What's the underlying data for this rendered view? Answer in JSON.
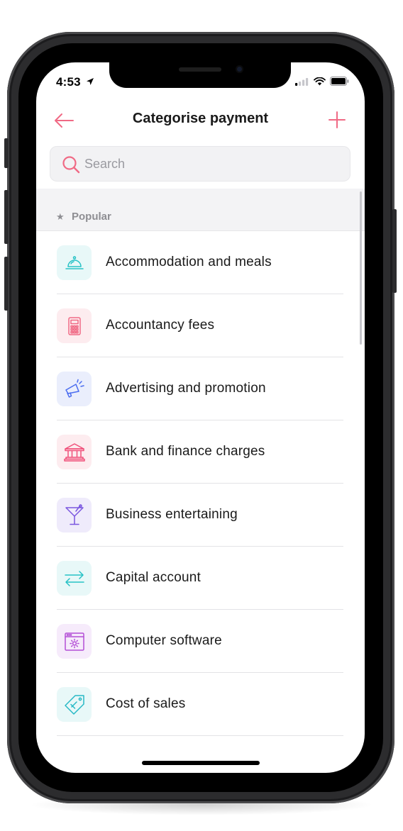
{
  "status_bar": {
    "time": "4:53"
  },
  "header": {
    "title": "Categorise payment"
  },
  "search": {
    "placeholder": "Search"
  },
  "section": {
    "label": "Popular"
  },
  "categories": [
    {
      "label": "Accommodation and meals",
      "icon": "service-bell-icon",
      "color": "#27c2c6",
      "bg": "#e8f8f8"
    },
    {
      "label": "Accountancy fees",
      "icon": "calculator-icon",
      "color": "#f06a85",
      "bg": "#fdecef"
    },
    {
      "label": "Advertising and promotion",
      "icon": "megaphone-icon",
      "color": "#4a6cf0",
      "bg": "#eaeefc"
    },
    {
      "label": "Bank and finance charges",
      "icon": "bank-icon",
      "color": "#f0507a",
      "bg": "#fdecef"
    },
    {
      "label": "Business entertaining",
      "icon": "cocktail-icon",
      "color": "#7a56e0",
      "bg": "#efebfb"
    },
    {
      "label": "Capital account",
      "icon": "transfer-arrows-icon",
      "color": "#27c2c6",
      "bg": "#e8f8f8"
    },
    {
      "label": "Computer software",
      "icon": "software-window-icon",
      "color": "#b34ed6",
      "bg": "#f6ebfb"
    },
    {
      "label": "Cost of sales",
      "icon": "price-tag-icon",
      "color": "#27b9c6",
      "bg": "#e8f8f8"
    }
  ],
  "colors": {
    "accent": "#f06a85"
  }
}
